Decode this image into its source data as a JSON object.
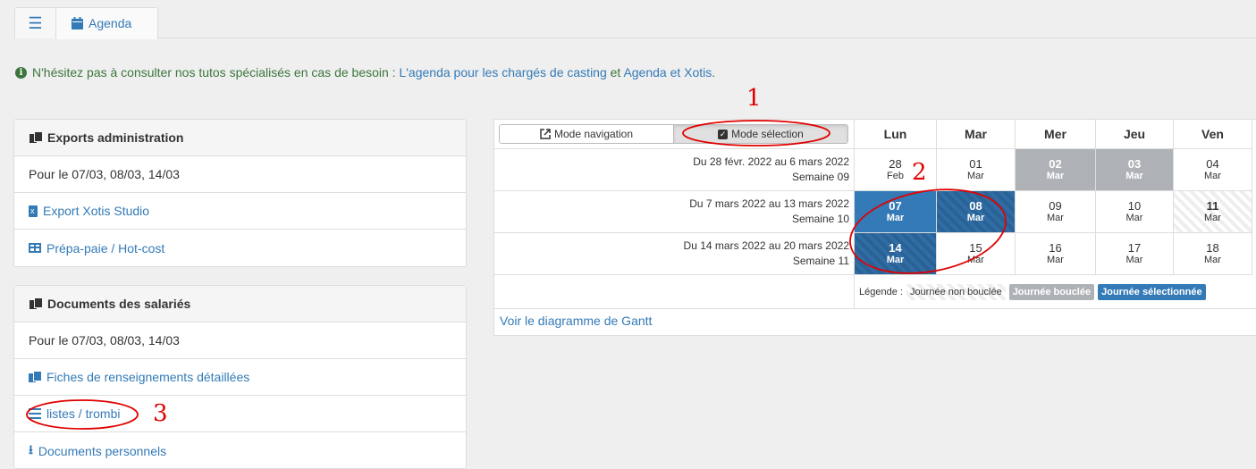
{
  "tabs": {
    "agenda": "Agenda"
  },
  "info": {
    "text_before": "N'hésitez pas à consulter nos tutos spécialisés en cas de besoin : ",
    "link1": "L'agenda pour les chargés de casting",
    "text_mid": " et ",
    "link2": "Agenda et Xotis",
    "text_end": "."
  },
  "exports": {
    "title": "Exports administration",
    "dates": "Pour le 07/03, 08/03, 14/03",
    "xotis": "Export Xotis Studio",
    "prepa": "Prépa-paie / Hot-cost"
  },
  "documents": {
    "title": "Documents des salariés",
    "dates": "Pour le 07/03, 08/03, 14/03",
    "fiches": "Fiches de renseignements détaillées",
    "listes": "listes / trombi",
    "perso": "Documents personnels"
  },
  "calendar": {
    "mode_navigation": "Mode navigation",
    "mode_selection": "Mode sélection",
    "days": [
      "Lun",
      "Mar",
      "Mer",
      "Jeu",
      "Ven"
    ],
    "weeks": [
      {
        "range": "Du 28 févr. 2022 au 6 mars 2022",
        "label": "Semaine 09",
        "cells": [
          [
            "28",
            "Feb"
          ],
          [
            "01",
            "Mar"
          ],
          [
            "02",
            "Mar"
          ],
          [
            "03",
            "Mar"
          ],
          [
            "04",
            "Mar"
          ]
        ]
      },
      {
        "range": "Du 7 mars 2022 au 13 mars 2022",
        "label": "Semaine 10",
        "cells": [
          [
            "07",
            "Mar"
          ],
          [
            "08",
            "Mar"
          ],
          [
            "09",
            "Mar"
          ],
          [
            "10",
            "Mar"
          ],
          [
            "11",
            "Mar"
          ]
        ]
      },
      {
        "range": "Du 14 mars 2022 au 20 mars 2022",
        "label": "Semaine 11",
        "cells": [
          [
            "14",
            "Mar"
          ],
          [
            "15",
            "Mar"
          ],
          [
            "16",
            "Mar"
          ],
          [
            "17",
            "Mar"
          ],
          [
            "18",
            "Mar"
          ]
        ]
      }
    ],
    "legend_label": "Légende :",
    "legend_open": "Journée non bouclée",
    "legend_closed": "Journée bouclée",
    "legend_selected": "Journée sélectionnée",
    "gantt": "Voir le diagramme de Gantt"
  },
  "annotations": [
    "1",
    "2",
    "3"
  ],
  "colors": {
    "accent": "#337ab7",
    "annotation": "#e00000",
    "info": "#3c763d"
  }
}
